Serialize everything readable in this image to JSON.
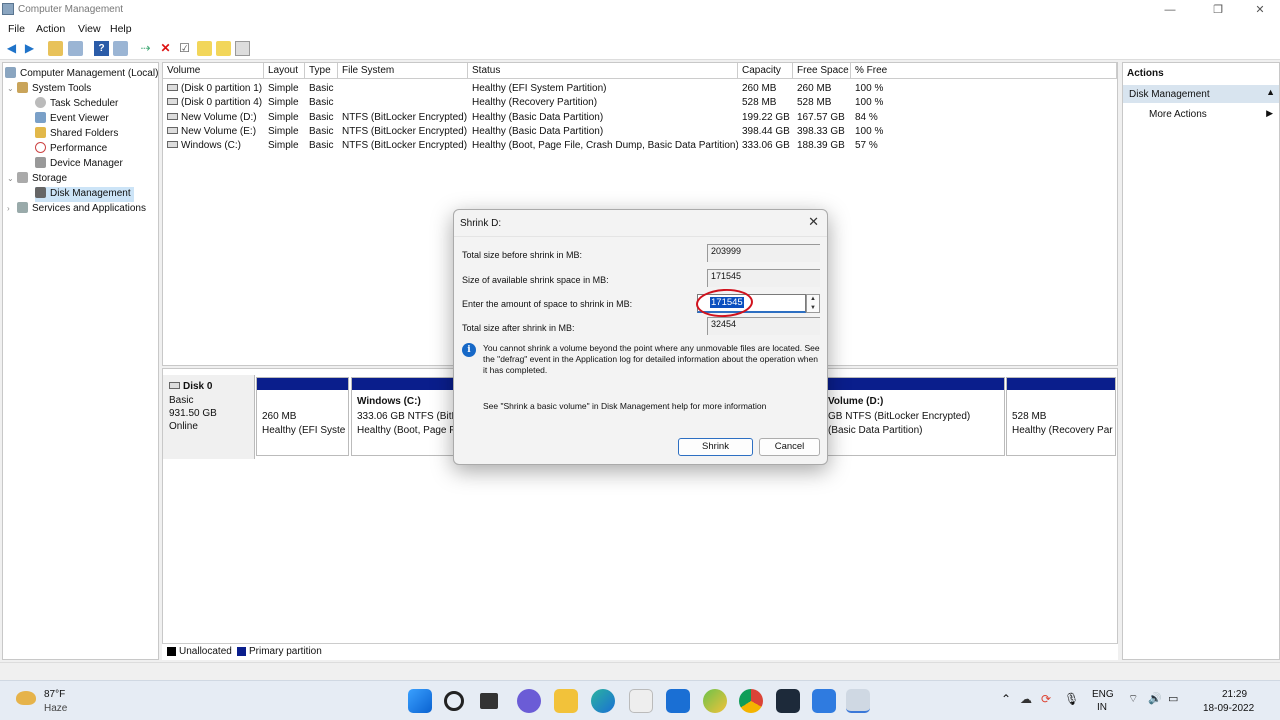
{
  "window": {
    "title": "Computer Management"
  },
  "menu": [
    "File",
    "Action",
    "View",
    "Help"
  ],
  "tree": {
    "root": "Computer Management (Local)",
    "items": [
      "System Tools",
      "Task Scheduler",
      "Event Viewer",
      "Shared Folders",
      "Performance",
      "Device Manager",
      "Storage",
      "Disk Management",
      "Services and Applications"
    ]
  },
  "table": {
    "headers": [
      "Volume",
      "Layout",
      "Type",
      "File System",
      "Status",
      "Capacity",
      "Free Space",
      "% Free"
    ],
    "rows": [
      [
        "(Disk 0 partition 1)",
        "Simple",
        "Basic",
        "",
        "Healthy (EFI System Partition)",
        "260 MB",
        "260 MB",
        "100 %"
      ],
      [
        "(Disk 0 partition 4)",
        "Simple",
        "Basic",
        "",
        "Healthy (Recovery Partition)",
        "528 MB",
        "528 MB",
        "100 %"
      ],
      [
        "New Volume (D:)",
        "Simple",
        "Basic",
        "NTFS (BitLocker Encrypted)",
        "Healthy (Basic Data Partition)",
        "199.22 GB",
        "167.57 GB",
        "84 %"
      ],
      [
        "New Volume (E:)",
        "Simple",
        "Basic",
        "NTFS (BitLocker Encrypted)",
        "Healthy (Basic Data Partition)",
        "398.44 GB",
        "398.33 GB",
        "100 %"
      ],
      [
        "Windows (C:)",
        "Simple",
        "Basic",
        "NTFS (BitLocker Encrypted)",
        "Healthy (Boot, Page File, Crash Dump, Basic Data Partition)",
        "333.06 GB",
        "188.39 GB",
        "57 %"
      ]
    ]
  },
  "disk": {
    "name": "Disk 0",
    "type": "Basic",
    "size": "931.50 GB",
    "state": "Online",
    "partitions": [
      {
        "title": "",
        "line1": "260 MB",
        "line2": "Healthy (EFI Syster"
      },
      {
        "title": "Windows  (C:)",
        "line1": "333.06 GB NTFS (BitL",
        "line2": "Healthy (Boot, Page F"
      },
      {
        "title": "Volume  (D:)",
        "line1": "GB NTFS (BitLocker Encrypted)",
        "line2": "(Basic Data Partition)"
      },
      {
        "title": "",
        "line1": "528 MB",
        "line2": "Healthy (Recovery Par"
      }
    ]
  },
  "legend": {
    "unallocated": "Unallocated",
    "primary": "Primary partition"
  },
  "actions": {
    "header": "Actions",
    "section": "Disk Management",
    "more": "More Actions"
  },
  "dialog": {
    "title": "Shrink D:",
    "label_total": "Total size before shrink in MB:",
    "value_total": "203999",
    "label_avail": "Size of available shrink space in MB:",
    "value_avail": "171545",
    "label_amount": "Enter the amount of space to shrink in MB:",
    "value_amount": "171545",
    "label_after": "Total size after shrink in MB:",
    "value_after": "32454",
    "info": "You cannot shrink a volume beyond the point where any unmovable files are located. See the \"defrag\" event in the Application log for detailed information about the operation when it has completed.",
    "help": "See \"Shrink a basic volume\" in Disk Management help for more information",
    "shrink": "Shrink",
    "cancel": "Cancel"
  },
  "taskbar": {
    "temp": "87°F",
    "weather": "Haze",
    "lang1": "ENG",
    "lang2": "IN",
    "time": "21:29",
    "date": "18-09-2022"
  },
  "colors": {
    "primary_partition": "#0a1e8c",
    "selection": "#0a4fbf",
    "annotation": "#d0121d"
  }
}
